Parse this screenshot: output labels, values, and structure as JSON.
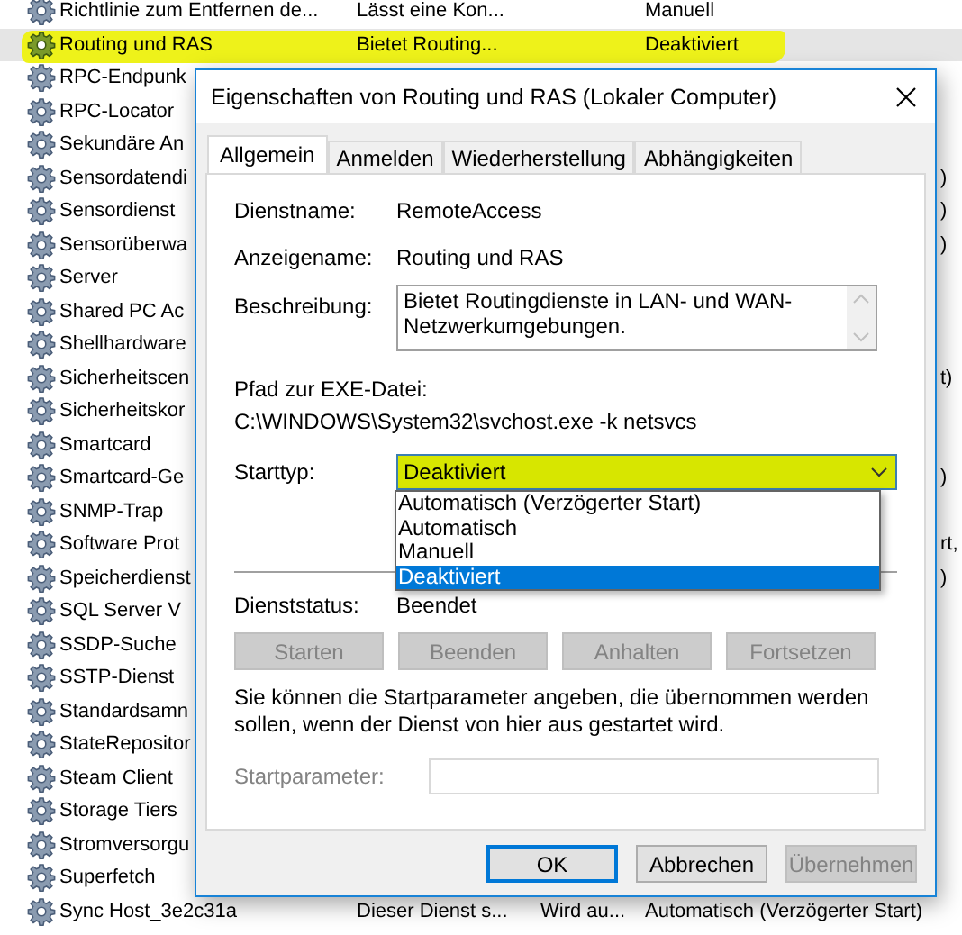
{
  "services": {
    "rows": [
      {
        "kind": "full",
        "name": "Richtlinie zum Entfernen de...",
        "description": "Lässt eine Kon...",
        "start_type": "Manuell",
        "selected": false,
        "highlighted": false
      },
      {
        "kind": "full",
        "name": "Routing und RAS",
        "description": "Bietet Routing...",
        "start_type": "Deaktiviert",
        "selected": true,
        "highlighted": true
      },
      {
        "kind": "covered",
        "name": "RPC-Endpunk",
        "selected": false,
        "highlighted": false
      },
      {
        "kind": "covered",
        "name": "RPC-Locator",
        "selected": false,
        "highlighted": false
      },
      {
        "kind": "covered",
        "name": "Sekundäre An",
        "selected": false,
        "highlighted": false
      },
      {
        "kind": "covered",
        "name": "Sensordatendi",
        "start_type": ")",
        "selected": false,
        "highlighted": false
      },
      {
        "kind": "covered",
        "name": "Sensordienst",
        "start_type": ")",
        "selected": false,
        "highlighted": false
      },
      {
        "kind": "covered",
        "name": "Sensorüberwa",
        "start_type": ")",
        "selected": false,
        "highlighted": false
      },
      {
        "kind": "covered",
        "name": "Server",
        "selected": false,
        "highlighted": false
      },
      {
        "kind": "covered",
        "name": "Shared PC Ac",
        "selected": false,
        "highlighted": false
      },
      {
        "kind": "covered",
        "name": "Shellhardware",
        "selected": false,
        "highlighted": false
      },
      {
        "kind": "covered",
        "name": "Sicherheitscen",
        "start_type": "t)",
        "selected": false,
        "highlighted": false
      },
      {
        "kind": "covered",
        "name": "Sicherheitskor",
        "selected": false,
        "highlighted": false
      },
      {
        "kind": "covered",
        "name": "Smartcard",
        "selected": false,
        "highlighted": false
      },
      {
        "kind": "covered",
        "name": "Smartcard-Ge",
        "start_type": ")",
        "selected": false,
        "highlighted": false
      },
      {
        "kind": "covered",
        "name": "SNMP-Trap",
        "selected": false,
        "highlighted": false
      },
      {
        "kind": "covered",
        "name": "Software Prot",
        "start_type": "rt,",
        "selected": false,
        "highlighted": false
      },
      {
        "kind": "covered",
        "name": "Speicherdienst",
        "start_type": ")",
        "selected": false,
        "highlighted": false
      },
      {
        "kind": "covered",
        "name": "SQL Server V",
        "selected": false,
        "highlighted": false
      },
      {
        "kind": "covered",
        "name": "SSDP-Suche",
        "selected": false,
        "highlighted": false
      },
      {
        "kind": "covered",
        "name": "SSTP-Dienst",
        "selected": false,
        "highlighted": false
      },
      {
        "kind": "covered",
        "name": "Standardsamn",
        "selected": false,
        "highlighted": false
      },
      {
        "kind": "covered",
        "name": "StateRepositor",
        "selected": false,
        "highlighted": false
      },
      {
        "kind": "covered",
        "name": "Steam Client",
        "selected": false,
        "highlighted": false
      },
      {
        "kind": "covered",
        "name": "Storage Tiers",
        "selected": false,
        "highlighted": false
      },
      {
        "kind": "covered",
        "name": "Stromversorgu",
        "selected": false,
        "highlighted": false
      },
      {
        "kind": "covered",
        "name": "Superfetch",
        "selected": false,
        "highlighted": false
      },
      {
        "kind": "full",
        "name": "Sync Host_3e2c31a",
        "description": "Dieser Dienst s...",
        "status": "Wird au...",
        "start_type": "Automatisch (Verzögerter Start)",
        "selected": false,
        "highlighted": false
      }
    ]
  },
  "dialog": {
    "title": "Eigenschaften von Routing und RAS (Lokaler Computer)",
    "tabs": [
      {
        "label": "Allgemein",
        "selected": true
      },
      {
        "label": "Anmelden",
        "selected": false
      },
      {
        "label": "Wiederherstellung",
        "selected": false
      },
      {
        "label": "Abhängigkeiten",
        "selected": false
      }
    ],
    "service_name": {
      "label": "Dienstname:",
      "value": "RemoteAccess"
    },
    "display_name": {
      "label": "Anzeigename:",
      "value": "Routing und RAS"
    },
    "description": {
      "label": "Beschreibung:",
      "value": "Bietet Routingdienste in LAN- und WAN-Netzwerkumgebungen."
    },
    "executable_path": {
      "label": "Pfad zur EXE-Datei:",
      "value": "C:\\WINDOWS\\System32\\svchost.exe -k netsvcs"
    },
    "startup_type": {
      "label": "Starttyp:",
      "value": "Deaktiviert",
      "highlighted": true,
      "expanded": true,
      "options": [
        {
          "label": "Automatisch (Verzögerter Start)",
          "selected": false
        },
        {
          "label": "Automatisch",
          "selected": false
        },
        {
          "label": "Manuell",
          "selected": false
        },
        {
          "label": "Deaktiviert",
          "selected": true
        }
      ]
    },
    "service_status": {
      "label": "Dienststatus:",
      "value": "Beendet"
    },
    "service_buttons": [
      {
        "label": "Starten",
        "disabled": true
      },
      {
        "label": "Beenden",
        "disabled": true
      },
      {
        "label": "Anhalten",
        "disabled": true
      },
      {
        "label": "Fortsetzen",
        "disabled": true
      }
    ],
    "hint": "Sie können die Startparameter angeben, die übernommen werden sollen, wenn der Dienst von hier aus gestartet wird.",
    "start_parameters": {
      "label": "Startparameter:",
      "disabled": true
    },
    "buttons": [
      {
        "label": "OK",
        "default": true,
        "disabled": false
      },
      {
        "label": "Abbrechen",
        "default": false,
        "disabled": false
      },
      {
        "label": "Übernehmen",
        "default": false,
        "disabled": true
      }
    ]
  }
}
